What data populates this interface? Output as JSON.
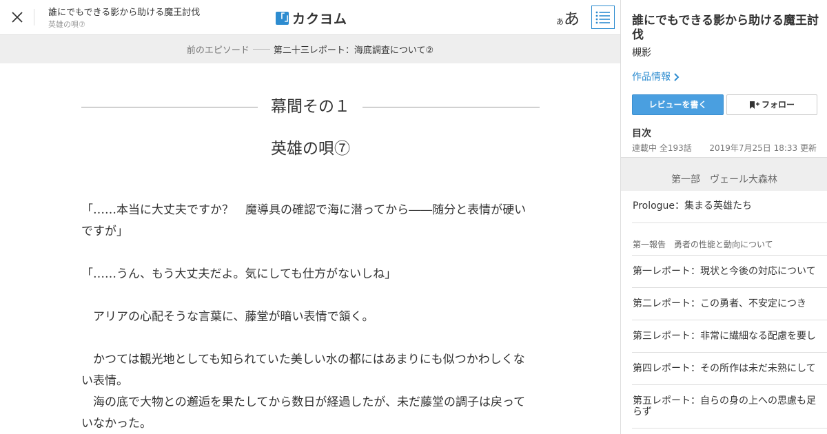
{
  "header": {
    "work_title": "誰にでもできる影から助ける魔王討伐",
    "episode_subtitle": "英雄の唄⑦",
    "logo_mark": "「」",
    "logo_text": "カクヨム",
    "font_size_small": "あ",
    "font_size_large": "あ",
    "icons": {
      "close": "close-icon",
      "toc": "list-icon"
    }
  },
  "prev_episode": {
    "label": "前のエピソード",
    "title": "第二十三レポート：海底調査について②"
  },
  "episode": {
    "chapter": "幕間その１",
    "title": "英雄の唄⑦",
    "paragraphs": [
      "「……本当に大丈夫ですか？　魔導具の確認で海に潜ってから――随分と表情が硬いですが」",
      "",
      "「……うん、もう大丈夫だよ。気にしても仕方がないしね」",
      "",
      "　アリアの心配そうな言葉に、藤堂が暗い表情で頷く。",
      "",
      "　かつては観光地としても知られていた美しい水の都にはあまりにも似つかわしくない表情。",
      "　海の底で大物との邂逅を果たしてから数日が経過したが、未だ藤堂の調子は戻っていなかった。"
    ]
  },
  "sidebar": {
    "work_title": "誰にでもできる影から助ける魔王討伐",
    "author": "槻影",
    "work_info_link": "作品情報",
    "review_button": "レビューを書く",
    "follow_button": "フォロー",
    "toc_label": "目次",
    "status": "連載中 全193話",
    "updated": "2019年7月25日 18:33 更新",
    "part_title": "第一部　ヴェール大森林",
    "first_item": "Prologue：集まる英雄たち",
    "section_title": "第一報告　勇者の性能と動向について",
    "items": [
      "第一レポート：現状と今後の対応について",
      "第二レポート：この勇者、不安定につき",
      "第三レポート：非常に繊細なる配慮を要し",
      "第四レポート：その所作は未だ未熟にして",
      "第五レポート：自らの身の上への思慮も足らず"
    ],
    "accent_color": "#2d8cd0"
  }
}
